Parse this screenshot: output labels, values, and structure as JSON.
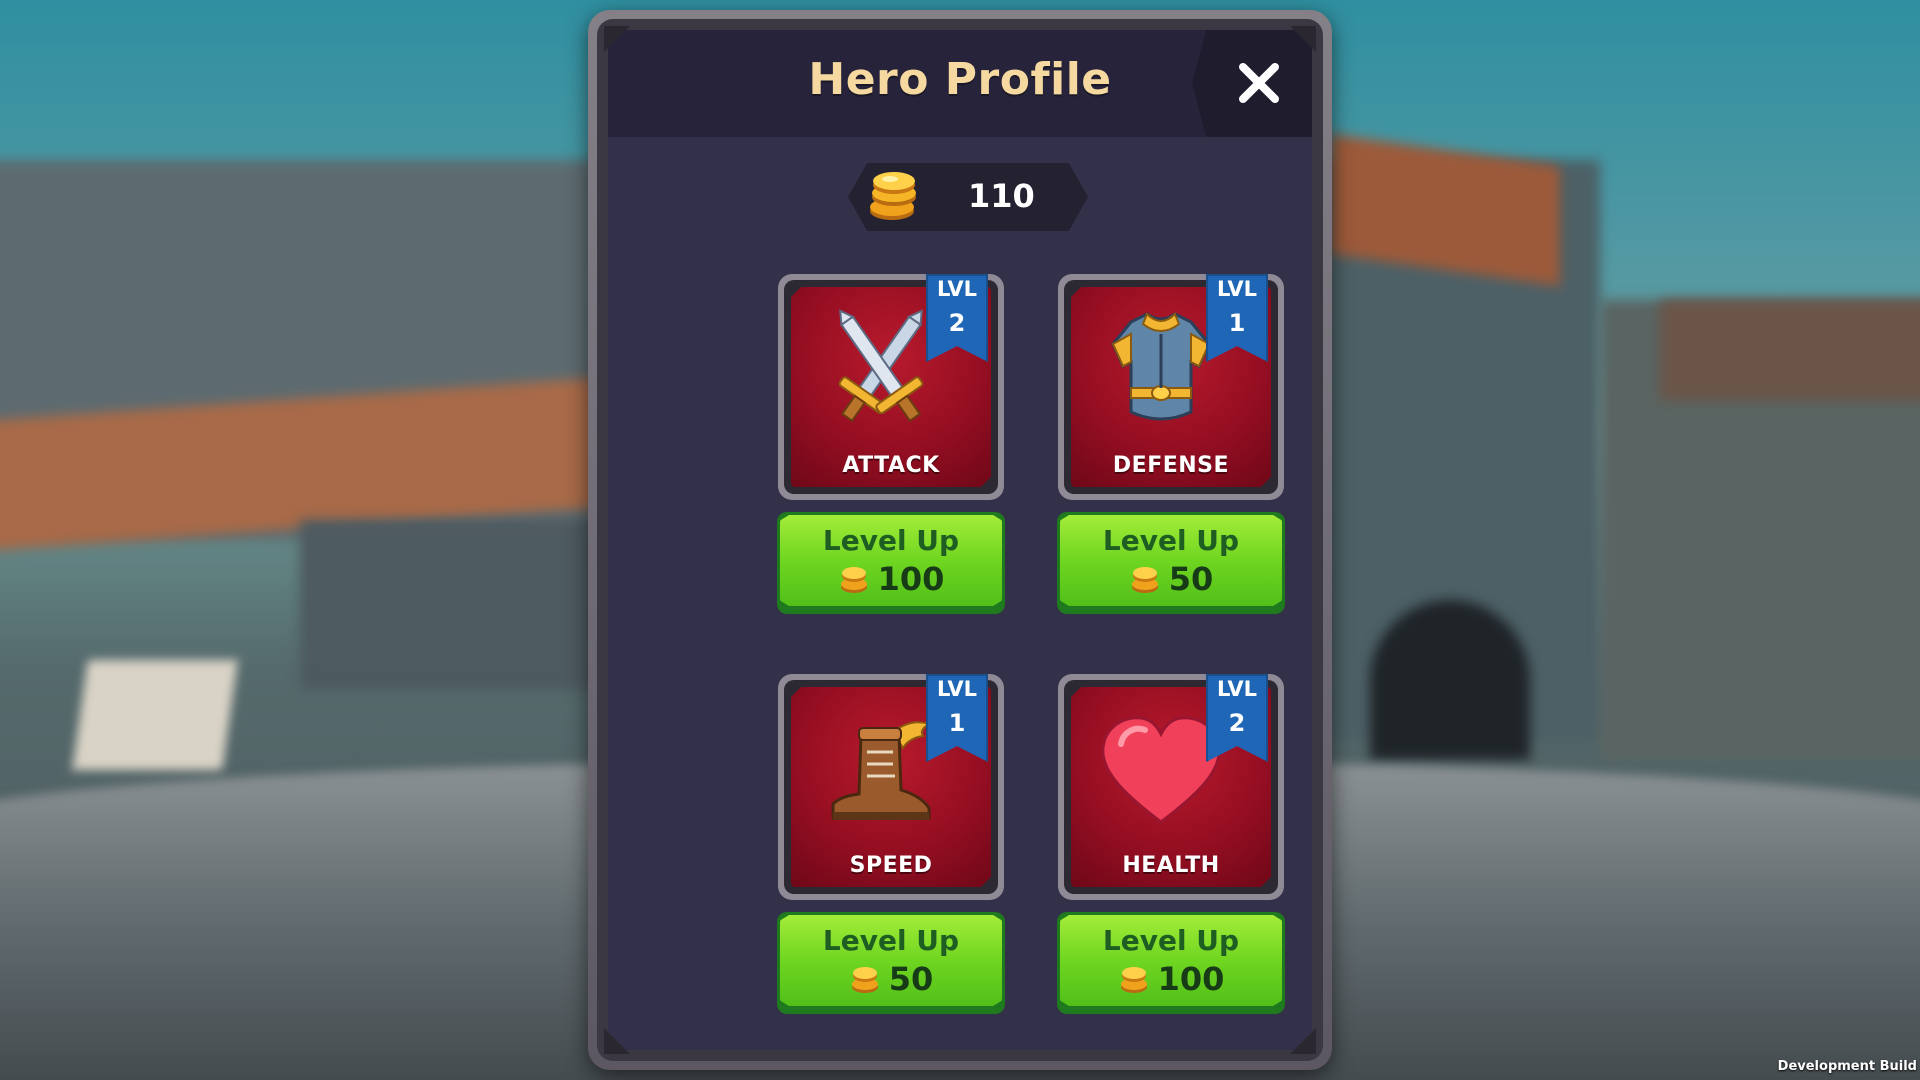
{
  "window": {
    "title": "Hero Profile",
    "close_icon": "close-icon"
  },
  "currency": {
    "icon": "coin-stack-icon",
    "amount": "110"
  },
  "stats": [
    {
      "name": "ATTACK",
      "level_prefix": "LVL",
      "level": "2",
      "icon": "crossed-swords-icon",
      "button_label": "Level Up",
      "cost": "100"
    },
    {
      "name": "DEFENSE",
      "level_prefix": "LVL",
      "level": "1",
      "icon": "armor-icon",
      "button_label": "Level Up",
      "cost": "50"
    },
    {
      "name": "SPEED",
      "level_prefix": "LVL",
      "level": "1",
      "icon": "winged-boot-icon",
      "button_label": "Level Up",
      "cost": "50"
    },
    {
      "name": "HEALTH",
      "level_prefix": "LVL",
      "level": "2",
      "icon": "heart-icon",
      "button_label": "Level Up",
      "cost": "100"
    }
  ],
  "footer": {
    "build_label": "Development Build"
  },
  "colors": {
    "title": "#f6d9a0",
    "card_red": "#960e22",
    "ribbon_blue": "#1f66b6",
    "button_green": "#6fd620"
  }
}
